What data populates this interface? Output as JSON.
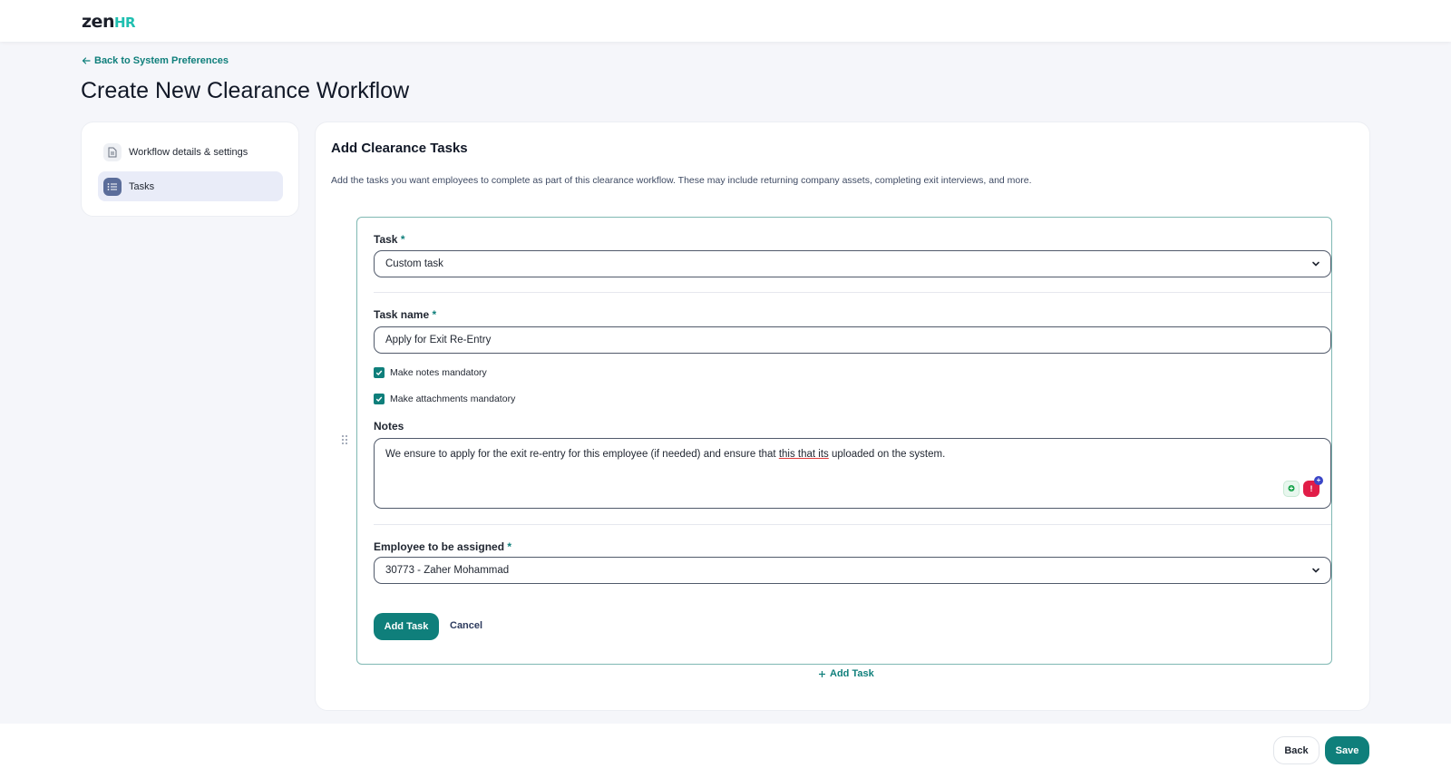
{
  "brand": {
    "logo_main": "zen",
    "logo_accent": "HR",
    "accent_color": "#0f7f7b"
  },
  "header": {
    "back_link": "Back to System Preferences",
    "page_title": "Create New Clearance Workflow"
  },
  "sidebar": {
    "items": [
      {
        "label": "Workflow details & settings",
        "icon": "document-icon",
        "active": false
      },
      {
        "label": "Tasks",
        "icon": "list-icon",
        "active": true
      }
    ]
  },
  "main": {
    "title": "Add Clearance Tasks",
    "description": "Add the tasks you want employees to complete as part of this clearance workflow. These may include returning company assets, completing exit interviews, and more.",
    "task_form": {
      "task_label": "Task",
      "task_value": "Custom task",
      "task_name_label": "Task name",
      "task_name_value": "Apply for Exit Re-Entry",
      "checkbox_notes": "Make notes mandatory",
      "checkbox_attachments": "Make attachments mandatory",
      "notes_label": "Notes",
      "notes_before": "We ensure to apply for the exit re-entry for this employee (if needed) and ensure that ",
      "notes_misspelled": "this that its",
      "notes_after": " uploaded on the system.",
      "employee_label": "Employee to be assigned",
      "employee_value": "30773 - Zaher Mohammad",
      "required_mark": "*",
      "add_task_button": "Add Task",
      "cancel_button": "Cancel"
    },
    "add_task_link": "Add Task"
  },
  "footer": {
    "back_button": "Back",
    "save_button": "Save"
  }
}
